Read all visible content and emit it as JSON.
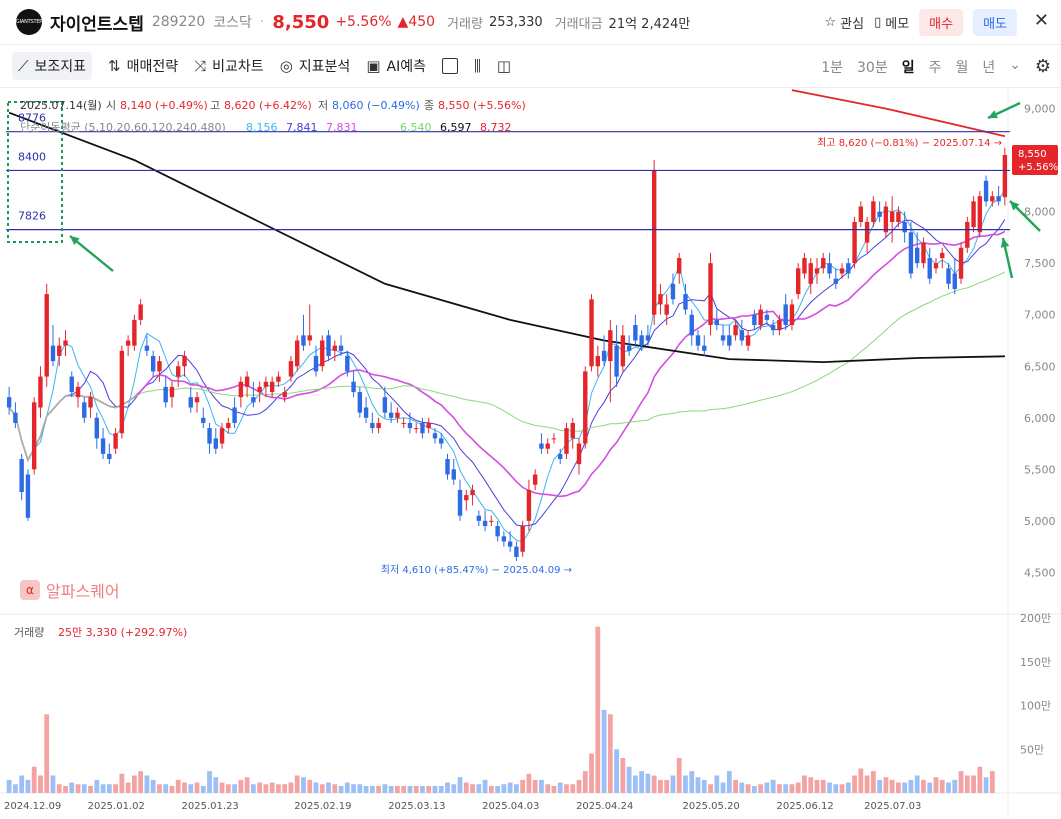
{
  "header": {
    "logo_text": "GIANTSTEP",
    "name": "자이언트스텝",
    "code": "289220",
    "market": "코스닥",
    "price": "8,550",
    "change_pct": "+5.56%",
    "change_abs": "▲450",
    "volume_label": "거래량",
    "volume": "253,330",
    "amount_label": "거래대금",
    "amount": "21억 2,424만",
    "watch_label": "관심",
    "memo_label": "메모",
    "buy_label": "매수",
    "sell_label": "매도",
    "close_icon": "x-icon"
  },
  "toolbar": {
    "items": [
      {
        "label": "보조지표",
        "icon": "line-chart-icon"
      },
      {
        "label": "매매전략",
        "icon": "updown-arrows-icon"
      },
      {
        "label": "비교차트",
        "icon": "shuffle-icon"
      },
      {
        "label": "지표분석",
        "icon": "binoculars-icon"
      },
      {
        "label": "AI예측",
        "icon": "ai-chip-icon"
      }
    ],
    "periods": [
      "1분",
      "30분",
      "일",
      "주",
      "월",
      "년"
    ],
    "selected_period": "일"
  },
  "chart_data": {
    "type": "candlestick",
    "ohlc_label": "2025.07.14(월)",
    "ohlc": {
      "open_label": "시",
      "open": "8,140 (+0.49%)",
      "high_label": "고",
      "high": "8,620 (+6.42%)",
      "low_label": "저",
      "low": "8,060 (−0.49%)",
      "close_label": "종",
      "close": "8,550 (+5.56%)"
    },
    "ma_label": "단순이동평균 (5,10,20,60,120,240,480)",
    "ma_values": [
      {
        "value": "8,156",
        "color": "#3db4f0"
      },
      {
        "value": "7,841",
        "color": "#4a3fd8"
      },
      {
        "value": "7,831",
        "color": "#d44ee0"
      },
      {
        "value": "6,540",
        "color": "#7ed46a"
      },
      {
        "value": "6,597",
        "color": "#111111"
      },
      {
        "value": "8,732",
        "color": "#e4262b"
      }
    ],
    "levels": [
      {
        "label": "8776",
        "value": 8776
      },
      {
        "label": "8400",
        "value": 8400
      },
      {
        "label": "7826",
        "value": 7826
      }
    ],
    "yaxis": {
      "min": 4300,
      "max": 9200,
      "ticks": [
        "9,000",
        "8,500",
        "8,000",
        "7,500",
        "7,000",
        "6,500",
        "6,000",
        "5,500",
        "5,000",
        "4,500"
      ]
    },
    "x_labels": [
      "2024.12.09",
      "2025.01.02",
      "2025.01.23",
      "2025.02.19",
      "2025.03.13",
      "2025.04.03",
      "2025.04.24",
      "2025.05.20",
      "2025.06.12",
      "2025.07.03"
    ],
    "x_label_index": [
      0,
      17,
      32,
      50,
      65,
      80,
      95,
      112,
      127,
      141
    ],
    "high_annot": "최고 8,620 (−0.81%) − 2025.07.14 →",
    "low_annot": "최저 4,610 (+85.47%) − 2025.04.09 →",
    "last_price": "8,550",
    "last_pct": "+5.56%",
    "candles": [
      [
        6200,
        6300,
        6030,
        6100
      ],
      [
        6050,
        6150,
        5900,
        5950
      ],
      [
        5600,
        5650,
        5200,
        5280
      ],
      [
        5450,
        5500,
        5000,
        5030
      ],
      [
        5500,
        6200,
        5450,
        6150
      ],
      [
        6100,
        6500,
        6000,
        6400
      ],
      [
        6400,
        7300,
        6300,
        7200
      ],
      [
        6700,
        6900,
        6500,
        6550
      ],
      [
        6600,
        6780,
        6500,
        6700
      ],
      [
        6700,
        6850,
        6600,
        6750
      ],
      [
        6400,
        6450,
        6200,
        6250
      ],
      [
        6200,
        6350,
        6100,
        6300
      ],
      [
        6150,
        6200,
        5950,
        6000
      ],
      [
        6100,
        6250,
        6000,
        6200
      ],
      [
        6000,
        6050,
        5700,
        5800
      ],
      [
        5800,
        5900,
        5600,
        5650
      ],
      [
        5650,
        5750,
        5550,
        5600
      ],
      [
        5700,
        5900,
        5650,
        5850
      ],
      [
        5850,
        6700,
        5800,
        6650
      ],
      [
        6700,
        6800,
        6600,
        6750
      ],
      [
        6700,
        7000,
        6650,
        6950
      ],
      [
        6950,
        7150,
        6900,
        7100
      ],
      [
        6700,
        6800,
        6600,
        6650
      ],
      [
        6600,
        6650,
        6400,
        6450
      ],
      [
        6450,
        6600,
        6350,
        6550
      ],
      [
        6300,
        6400,
        6100,
        6150
      ],
      [
        6200,
        6350,
        6100,
        6300
      ],
      [
        6400,
        6550,
        6300,
        6500
      ],
      [
        6500,
        6650,
        6400,
        6600
      ],
      [
        6200,
        6300,
        6050,
        6100
      ],
      [
        6150,
        6250,
        6050,
        6200
      ],
      [
        6000,
        6100,
        5900,
        5950
      ],
      [
        5900,
        5950,
        5650,
        5750
      ],
      [
        5800,
        5900,
        5650,
        5700
      ],
      [
        5750,
        5950,
        5700,
        5900
      ],
      [
        5900,
        6000,
        5850,
        5950
      ],
      [
        6100,
        6200,
        5900,
        5950
      ],
      [
        6200,
        6400,
        6100,
        6350
      ],
      [
        6300,
        6450,
        6200,
        6400
      ],
      [
        6200,
        6350,
        6100,
        6150
      ],
      [
        6250,
        6350,
        6150,
        6300
      ],
      [
        6300,
        6400,
        6200,
        6350
      ],
      [
        6250,
        6400,
        6200,
        6350
      ],
      [
        6350,
        6450,
        6300,
        6400
      ],
      [
        6200,
        6300,
        6150,
        6250
      ],
      [
        6400,
        6600,
        6350,
        6550
      ],
      [
        6500,
        6800,
        6450,
        6750
      ],
      [
        6800,
        7000,
        6650,
        6700
      ],
      [
        6750,
        7100,
        6700,
        6800
      ],
      [
        6600,
        6700,
        6400,
        6450
      ],
      [
        6500,
        6800,
        6450,
        6750
      ],
      [
        6800,
        6850,
        6550,
        6600
      ],
      [
        6650,
        6750,
        6550,
        6700
      ],
      [
        6700,
        6800,
        6600,
        6650
      ],
      [
        6600,
        6650,
        6400,
        6450
      ],
      [
        6350,
        6450,
        6200,
        6250
      ],
      [
        6250,
        6300,
        6000,
        6050
      ],
      [
        6100,
        6200,
        5950,
        6000
      ],
      [
        5950,
        6050,
        5850,
        5900
      ],
      [
        5900,
        6000,
        5850,
        5950
      ],
      [
        6200,
        6300,
        6000,
        6050
      ],
      [
        6050,
        6150,
        5950,
        6000
      ],
      [
        6000,
        6100,
        5950,
        6050
      ],
      [
        5950,
        6000,
        5900,
        5950
      ],
      [
        5950,
        6050,
        5850,
        5900
      ],
      [
        5900,
        5950,
        5850,
        5900
      ],
      [
        5950,
        6000,
        5800,
        5850
      ],
      [
        5900,
        6000,
        5850,
        5950
      ],
      [
        5850,
        5900,
        5750,
        5800
      ],
      [
        5800,
        5850,
        5700,
        5750
      ],
      [
        5600,
        5650,
        5400,
        5450
      ],
      [
        5500,
        5600,
        5350,
        5400
      ],
      [
        5300,
        5400,
        5000,
        5050
      ],
      [
        5200,
        5300,
        5100,
        5250
      ],
      [
        5250,
        5350,
        5150,
        5300
      ],
      [
        5050,
        5100,
        4950,
        5000
      ],
      [
        5000,
        5100,
        4900,
        4950
      ],
      [
        5000,
        5050,
        4950,
        5000
      ],
      [
        4950,
        5000,
        4800,
        4850
      ],
      [
        4850,
        4900,
        4750,
        4800
      ],
      [
        4800,
        4900,
        4700,
        4750
      ],
      [
        4750,
        4800,
        4610,
        4650
      ],
      [
        4700,
        5000,
        4650,
        4950
      ],
      [
        5000,
        5400,
        4900,
        5300
      ],
      [
        5350,
        5500,
        5300,
        5450
      ],
      [
        5750,
        5850,
        5650,
        5700
      ],
      [
        5700,
        5800,
        5650,
        5750
      ],
      [
        5800,
        5850,
        5750,
        5800
      ],
      [
        5650,
        5700,
        5550,
        5600
      ],
      [
        5650,
        5950,
        5600,
        5900
      ],
      [
        5800,
        6000,
        5700,
        5950
      ],
      [
        5550,
        5800,
        5450,
        5750
      ],
      [
        5750,
        6500,
        5700,
        6450
      ],
      [
        6500,
        7200,
        6450,
        7150
      ],
      [
        6500,
        6700,
        6400,
        6600
      ],
      [
        6650,
        6800,
        6500,
        6550
      ],
      [
        6550,
        6950,
        6150,
        6850
      ],
      [
        6700,
        6900,
        6300,
        6400
      ],
      [
        6500,
        6900,
        6450,
        6800
      ],
      [
        6700,
        6800,
        6600,
        6650
      ],
      [
        6900,
        7000,
        6700,
        6750
      ],
      [
        6800,
        6850,
        6650,
        6700
      ],
      [
        6800,
        6900,
        6700,
        6750
      ],
      [
        7000,
        8500,
        6900,
        8400
      ],
      [
        7100,
        7300,
        7000,
        7200
      ],
      [
        7000,
        7200,
        6900,
        7100
      ],
      [
        7300,
        7400,
        7100,
        7150
      ],
      [
        7400,
        7600,
        7300,
        7550
      ],
      [
        7200,
        7300,
        7000,
        7050
      ],
      [
        7000,
        7050,
        6700,
        6800
      ],
      [
        6800,
        6850,
        6650,
        6700
      ],
      [
        6700,
        6800,
        6600,
        6650
      ],
      [
        6900,
        7600,
        6800,
        7500
      ],
      [
        6950,
        7050,
        6850,
        6900
      ],
      [
        6800,
        6900,
        6700,
        6750
      ],
      [
        6800,
        6900,
        6650,
        6700
      ],
      [
        6800,
        6950,
        6750,
        6900
      ],
      [
        6850,
        6950,
        6700,
        6750
      ],
      [
        6700,
        6850,
        6650,
        6800
      ],
      [
        7000,
        7050,
        6850,
        6900
      ],
      [
        6900,
        7100,
        6850,
        7050
      ],
      [
        7000,
        7050,
        6900,
        6950
      ],
      [
        6900,
        6950,
        6800,
        6850
      ],
      [
        6850,
        7000,
        6800,
        6950
      ],
      [
        7100,
        7200,
        6850,
        6900
      ],
      [
        6900,
        7150,
        6850,
        7100
      ],
      [
        7200,
        7500,
        7150,
        7450
      ],
      [
        7400,
        7600,
        7350,
        7550
      ],
      [
        7300,
        7550,
        7200,
        7500
      ],
      [
        7400,
        7550,
        7300,
        7450
      ],
      [
        7450,
        7600,
        7400,
        7550
      ],
      [
        7500,
        7600,
        7350,
        7400
      ],
      [
        7350,
        7450,
        7250,
        7300
      ],
      [
        7400,
        7500,
        7350,
        7450
      ],
      [
        7500,
        7550,
        7350,
        7400
      ],
      [
        7500,
        7950,
        7450,
        7900
      ],
      [
        7900,
        8100,
        7850,
        8050
      ],
      [
        7700,
        7950,
        7600,
        7900
      ],
      [
        7900,
        8150,
        7850,
        8100
      ],
      [
        8000,
        8100,
        7900,
        7950
      ],
      [
        7800,
        8100,
        7750,
        8050
      ],
      [
        7900,
        8150,
        7700,
        8000
      ],
      [
        7900,
        8050,
        7850,
        8000
      ],
      [
        7900,
        8000,
        7700,
        7800
      ],
      [
        7800,
        7900,
        7350,
        7400
      ],
      [
        7650,
        7800,
        7450,
        7500
      ],
      [
        7500,
        7750,
        7450,
        7700
      ],
      [
        7550,
        7650,
        7300,
        7350
      ],
      [
        7450,
        7550,
        7400,
        7500
      ],
      [
        7550,
        7650,
        7450,
        7600
      ],
      [
        7450,
        7500,
        7250,
        7300
      ],
      [
        7400,
        7550,
        7200,
        7250
      ],
      [
        7350,
        7700,
        7300,
        7650
      ],
      [
        7650,
        7950,
        7600,
        7900
      ],
      [
        7850,
        8150,
        7800,
        8100
      ],
      [
        7800,
        8200,
        7750,
        8150
      ],
      [
        8300,
        8350,
        8050,
        8100
      ],
      [
        8100,
        8200,
        8050,
        8150
      ],
      [
        8150,
        8250,
        8060,
        8100
      ],
      [
        8140,
        8620,
        8060,
        8550
      ]
    ],
    "volume": {
      "label": "거래량",
      "value": "25만 3,330 (+292.97%)",
      "ymax": 200,
      "ticks": [
        "200만",
        "150만",
        "100만",
        "50만"
      ],
      "values": [
        15,
        10,
        20,
        15,
        30,
        20,
        90,
        20,
        10,
        8,
        12,
        10,
        10,
        8,
        15,
        10,
        10,
        10,
        22,
        12,
        20,
        25,
        20,
        15,
        10,
        10,
        8,
        15,
        12,
        10,
        12,
        8,
        25,
        18,
        12,
        10,
        10,
        15,
        18,
        10,
        12,
        10,
        12,
        10,
        10,
        12,
        20,
        18,
        15,
        12,
        10,
        12,
        10,
        8,
        12,
        10,
        10,
        8,
        8,
        8,
        10,
        8,
        8,
        8,
        8,
        8,
        8,
        8,
        8,
        8,
        12,
        10,
        18,
        12,
        10,
        10,
        15,
        8,
        8,
        10,
        12,
        10,
        15,
        22,
        15,
        15,
        10,
        8,
        12,
        10,
        10,
        15,
        25,
        45,
        190,
        95,
        90,
        50,
        40,
        30,
        20,
        25,
        22,
        20,
        15,
        15,
        20,
        40,
        20,
        25,
        18,
        15,
        10,
        20,
        12,
        25,
        15,
        12,
        10,
        8,
        10,
        12,
        15,
        10,
        10,
        10,
        12,
        20,
        18,
        15,
        15,
        12,
        10,
        10,
        12,
        20,
        28,
        20,
        25,
        15,
        18,
        15,
        12,
        12,
        15,
        20,
        15,
        12,
        18,
        15,
        12,
        15,
        25,
        20,
        20,
        30,
        18,
        25
      ]
    }
  }
}
